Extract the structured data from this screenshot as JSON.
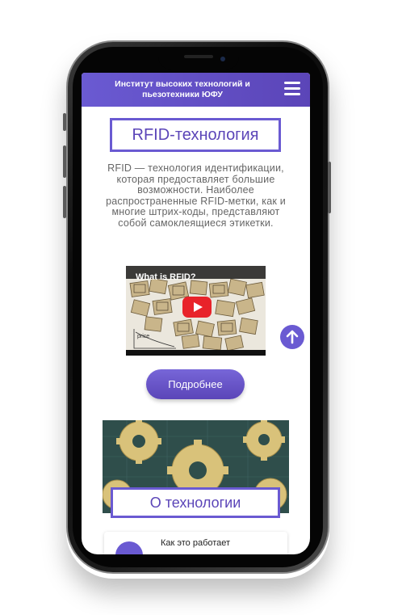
{
  "header": {
    "title": "Институт высоких технологий и пьезотехники ЮФУ",
    "menu_icon": "hamburger-menu-icon"
  },
  "main": {
    "title": "RFID-технология",
    "description": "RFID — технология идентификации, которая предоставляет большие возможности. Наиболее распространенные RFID-метки, как и многие штрих-коды, представляют собой самоклеящиеся этикетки.",
    "video": {
      "title": "What is RFID?",
      "play_icon": "youtube-play-icon",
      "chart_label": "price"
    },
    "more_button": "Подробнее",
    "scroll_up_icon": "arrow-up-icon"
  },
  "about": {
    "title": "О технологии",
    "card_label": "Как это работает"
  },
  "colors": {
    "accent": "#6a5ad2",
    "accent_dark": "#5b45b8",
    "gear_bg": "#2f4e4b",
    "gear": "#d9c27a",
    "youtube_red": "#e8232a"
  }
}
